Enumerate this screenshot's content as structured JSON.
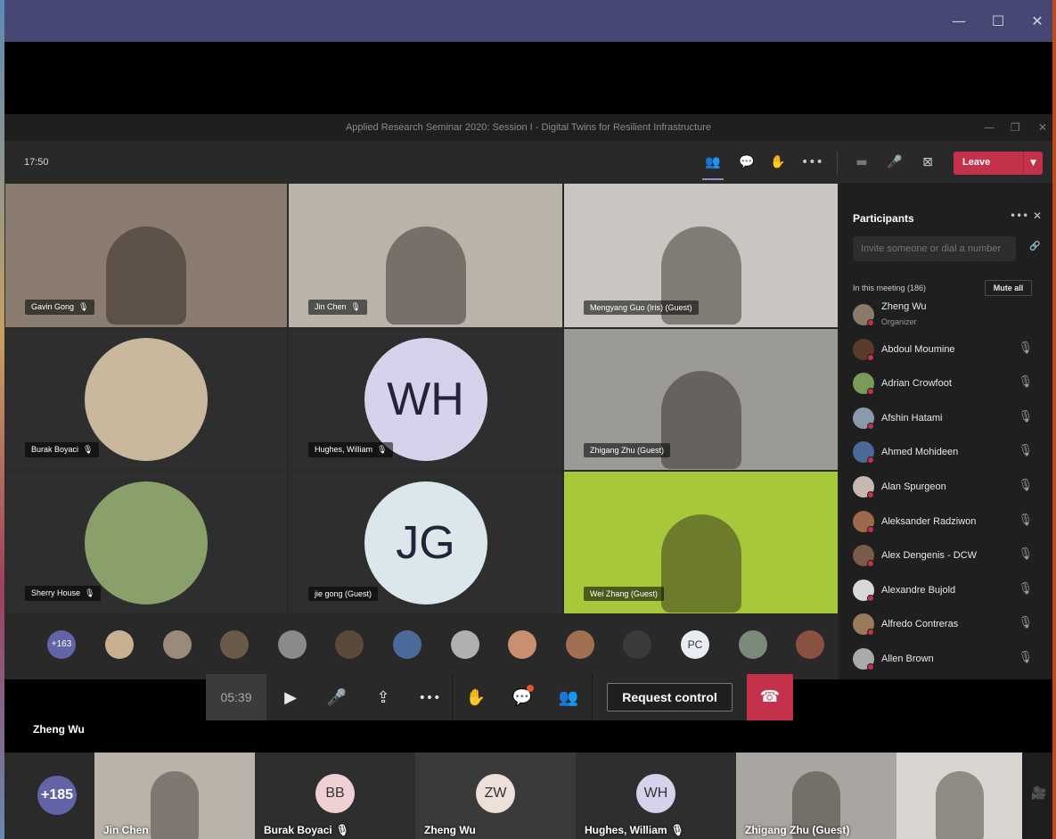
{
  "outer_window": {
    "minimize": "—",
    "maximize": "☐",
    "close": "✕"
  },
  "shared_window": {
    "title": "Applied Research Seminar 2020: Session I - Digital Twins for Resilient Infrastructure",
    "minimize": "—",
    "restore": "❐",
    "close": "✕"
  },
  "toolbar": {
    "elapsed": "17:50",
    "leave_label": "Leave",
    "leave_chevron": "▼",
    "icons": {
      "participants": "👥",
      "chat": "💬",
      "raise_hand": "✋",
      "more": "•••",
      "camera_off": "▬",
      "mic": "🎤",
      "share_stop": "⊠",
      "leave_phone": "☎"
    }
  },
  "video_tiles": [
    {
      "name": "Gavin Gong",
      "muted": true,
      "type": "video",
      "bg": "#8a7d70"
    },
    {
      "name": "Jin Chen",
      "muted": true,
      "type": "video",
      "bg": "#b9b3aa"
    },
    {
      "name": "Mengyang Guo (Iris) (Guest)",
      "muted": false,
      "type": "video",
      "bg": "#c9c6c2"
    },
    {
      "name": "Burak Boyaci",
      "muted": true,
      "type": "avatar",
      "bg": "#2e2e2e",
      "circle": "#c9b89b"
    },
    {
      "name": "Hughes, William",
      "muted": true,
      "type": "initials",
      "initials": "WH",
      "bg": "#2e2e2e",
      "circle": "#d7d2ec"
    },
    {
      "name": "Zhigang Zhu (Guest)",
      "muted": false,
      "type": "video",
      "bg": "#9c9a97"
    },
    {
      "name": "Sherry House",
      "muted": true,
      "type": "avatar",
      "bg": "#2e2e2e",
      "circle": "#8aa06a"
    },
    {
      "name": "jie gong (Guest)",
      "muted": false,
      "type": "initials",
      "initials": "JG",
      "bg": "#2e2e2e",
      "circle": "#dbe7ea"
    },
    {
      "name": "Wei Zhang (Guest)",
      "muted": false,
      "type": "video",
      "bg": "#a7c83a"
    }
  ],
  "strip": {
    "overflow": "+163",
    "pc_initials": "PC",
    "avatar_colors": [
      "#c8b090",
      "#9a8a7a",
      "#6a5a4a",
      "#8a8a8a",
      "#5a4a3a",
      "#4a6a9a",
      "#b0b0b0",
      "#c89070",
      "#a07050",
      "#3a3a3a",
      "#e8eef3",
      "#7a8a7a",
      "#8a5040"
    ]
  },
  "participants": {
    "title": "Participants",
    "more": "•••",
    "close": "✕",
    "invite_placeholder": "Invite someone or dial a number",
    "share_link_icon": "🔗",
    "in_meeting": "In this meeting (186)",
    "mute_all": "Mute all",
    "mute_icon": "🎙",
    "list": [
      {
        "name": "Zheng Wu",
        "sub": "Organizer",
        "color": "#8a7a6a"
      },
      {
        "name": "Abdoul Moumine",
        "color": "#5a3a2a"
      },
      {
        "name": "Adrian Crowfoot",
        "color": "#7a9a5a"
      },
      {
        "name": "Afshin Hatami",
        "color": "#8a9aaa"
      },
      {
        "name": "Ahmed Mohideen",
        "color": "#4a6a9a"
      },
      {
        "name": "Alan Spurgeon",
        "color": "#c8b8b0"
      },
      {
        "name": "Aleksander Radziwon",
        "color": "#9a6a4a"
      },
      {
        "name": "Alex Dengenis - DCW",
        "color": "#7a5a4a"
      },
      {
        "name": "Alexandre Bujold",
        "color": "#d8d8d8"
      },
      {
        "name": "Alfredo Contreras",
        "color": "#9a7a5a"
      },
      {
        "name": "Allen Brown",
        "color": "#aaaaaa"
      }
    ]
  },
  "callbar": {
    "timer": "05:39",
    "request_control": "Request control",
    "icons": {
      "camera": "▶",
      "mic": "🎤",
      "share": "⇪",
      "more": "•••",
      "hand": "✋",
      "chat": "💬",
      "people": "👥",
      "hangup": "☎"
    }
  },
  "presenter_name": "Zheng Wu",
  "gallery": [
    {
      "type": "count",
      "label": "+185",
      "bg": "#2a2a2a"
    },
    {
      "type": "video",
      "name": "Jin Chen",
      "bg": "#b9b3aa"
    },
    {
      "type": "initials",
      "initials": "BB",
      "name": "Burak Boyaci",
      "muted": true,
      "bg": "#2e2e2e",
      "circle": "#f1d0d4"
    },
    {
      "type": "initials",
      "initials": "ZW",
      "name": "Zheng Wu",
      "bg": "#3a3a3a",
      "circle": "#ece0d8"
    },
    {
      "type": "initials",
      "initials": "WH",
      "name": "Hughes, William",
      "muted": true,
      "bg": "#2e2e2e",
      "circle": "#d7d2ec"
    },
    {
      "type": "video",
      "name": "Zhigang Zhu (Guest)",
      "bg": "#a8a5a0"
    },
    {
      "type": "video",
      "name": "",
      "bg": "#d8d4cf"
    }
  ],
  "gallery_cam_icon": "🎥"
}
